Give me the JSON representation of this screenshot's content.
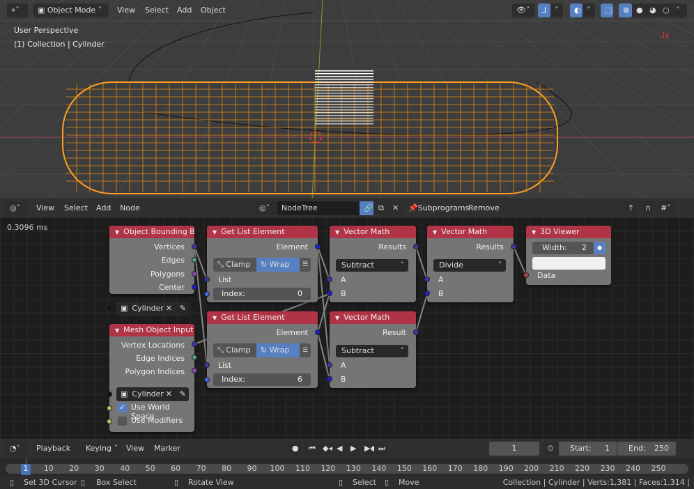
{
  "viewport": {
    "menu": [
      "View",
      "Select",
      "Add",
      "Object"
    ],
    "mode": "Object Mode",
    "overlay_line1": "User Perspective",
    "overlay_line2": "(1) Collection | Cylinder",
    "accent": "#5680c2",
    "selection_color": "#ffa020",
    "icons": [
      "editor-type-icon",
      "object-mode-icon",
      "visibility-icon",
      "transform-gizmo-icon",
      "overlays-icon",
      "xray-icon",
      "wireframe-shading-icon",
      "solid-shading-icon",
      "material-shading-icon",
      "rendered-shading-icon"
    ]
  },
  "node_editor": {
    "menu": [
      "View",
      "Select",
      "Add",
      "Node"
    ],
    "tree_name": "NodeTree",
    "programs_label": "Subprograms",
    "remove_label": "Remove",
    "timing": "0.3096 ms",
    "nodes": {
      "obb": {
        "title": "Object Bounding B..",
        "outputs": [
          "Vertices",
          "Edges",
          "Polygons",
          "Center"
        ],
        "object": "Cylinder"
      },
      "mesh": {
        "title": "Mesh Object Input",
        "outputs": [
          "Vertex Locations",
          "Edge Indices",
          "Polygon Indices"
        ],
        "object": "Cylinder",
        "world_space": "Use World Space",
        "world_space_checked": true,
        "modifiers": "Use Modifiers",
        "modifiers_checked": false
      },
      "gle1": {
        "title": "Get List Element",
        "output": "Element",
        "clamp": "Clamp",
        "wrap": "Wrap",
        "input": "List",
        "index_label": "Index:",
        "index": "0"
      },
      "gle2": {
        "title": "Get List Element",
        "output": "Element",
        "clamp": "Clamp",
        "wrap": "Wrap",
        "input": "List",
        "index_label": "Index:",
        "index": "6"
      },
      "vm1": {
        "title": "Vector Math",
        "output": "Results",
        "op": "Subtract",
        "a": "A",
        "b": "B"
      },
      "vm2": {
        "title": "Vector Math",
        "output": "Result",
        "op": "Subtract",
        "a": "A",
        "b": "B"
      },
      "vm3": {
        "title": "Vector Math",
        "output": "Results",
        "op": "Divide",
        "a": "A",
        "b": "B"
      },
      "viewer": {
        "title": "3D Viewer",
        "width_label": "Width:",
        "width": "2",
        "input": "Data"
      }
    }
  },
  "timeline": {
    "menu": [
      "Playback",
      "Keying",
      "View",
      "Marker"
    ],
    "current_frame": "1",
    "start_label": "Start:",
    "start": "1",
    "end_label": "End:",
    "end": "250",
    "ticks": [
      "1",
      "10",
      "20",
      "30",
      "40",
      "50",
      "60",
      "70",
      "80",
      "90",
      "100",
      "110",
      "120",
      "130",
      "140",
      "150",
      "160",
      "170",
      "180",
      "190",
      "200",
      "210",
      "220",
      "230",
      "240",
      "250"
    ]
  },
  "status": {
    "hints": [
      "Set 3D Cursor",
      "Box Select",
      "Rotate View",
      "Select",
      "Move"
    ],
    "info": "Collection | Cylinder | Verts:1,381 | Faces:1,314 |"
  }
}
